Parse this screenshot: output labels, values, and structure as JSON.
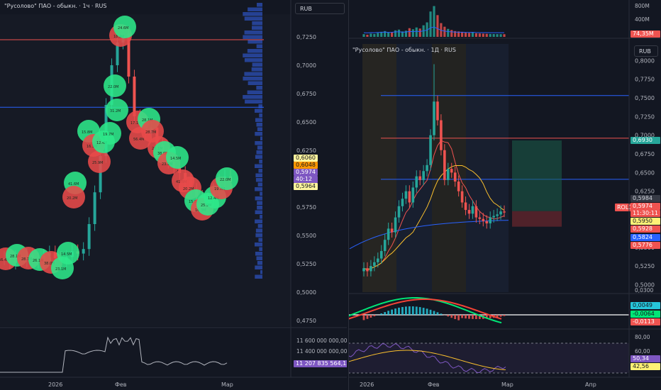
{
  "left_chart": {
    "title": "\"Русолово\" ПАО - обыкн. · 1ч · RUS",
    "currency_button": "RUB",
    "price_ticks": [
      "0,7250",
      "0,7000",
      "0,6750",
      "0,6500",
      "0,6250",
      "0,5750",
      "0,5500",
      "0,5250",
      "0,5000",
      "0,4750"
    ],
    "price_labels": [
      {
        "text": "0,6060",
        "bg": "#fff59d",
        "fg": "#131722"
      },
      {
        "text": "0,6048",
        "bg": "#ff9800",
        "fg": "#131722"
      },
      {
        "text": "0,5974",
        "bg": "#7e57c2",
        "fg": "#ffffff"
      },
      {
        "text": "40:12",
        "bg": "#7e57c2",
        "fg": "#ffffff"
      },
      {
        "text": "0,5964",
        "bg": "#fff59d",
        "fg": "#131722"
      }
    ],
    "volume_ticks": [
      "11 600 000 000,0000",
      "11 400 000 000,0000"
    ],
    "volume_label": {
      "text": "11 207 835 564,1570",
      "bg": "#7e57c2"
    },
    "time_labels": [
      "2026",
      "Фев",
      "Мар"
    ],
    "bubble_labels": [
      "56.4M",
      "28.1M",
      "28.7M",
      "26.1M",
      "38.0M",
      "23.1M",
      "14.5M",
      "41.6M",
      "20.2M",
      "15.8M",
      "16.3M",
      "25.9M",
      "12.4M",
      "19.7M",
      "22.0M",
      "31.2M",
      "18.3M",
      "24.6M",
      "17.1M"
    ],
    "colors": {
      "up": "#26a69a",
      "down": "#ef5350",
      "bubble_up": "#2ee88a",
      "bubble_down": "#e84a4a"
    }
  },
  "right_chart": {
    "title": "\"Русолово\" ПАО - обыкн. · 1Д · RUS",
    "currency_button": "RUB",
    "volume_ticks": [
      "800M",
      "400M"
    ],
    "volume_label": {
      "text": "74,35M",
      "bg": "#ef5350"
    },
    "price_ticks": [
      "0,8000",
      "0,7750",
      "0,7500",
      "0,7250",
      "0,7000",
      "0,6750",
      "0,6500",
      "0,6250",
      "0,6000",
      "0,5750",
      "0,5500",
      "0,5250",
      "0,5000"
    ],
    "symbol_badge": "ROLO",
    "price_labels": [
      {
        "text": "0,6930",
        "bg": "#26a69a",
        "fg": "#ffffff"
      },
      {
        "text": "0,5984",
        "bg": "#363a45",
        "fg": "#d1d4dc"
      },
      {
        "text": "0,5974",
        "bg": "#ef5350",
        "fg": "#ffffff"
      },
      {
        "text": "11:30:11",
        "bg": "#ef5350",
        "fg": "#ffffff"
      },
      {
        "text": "0,5950",
        "bg": "#fff176",
        "fg": "#131722"
      },
      {
        "text": "0,5928",
        "bg": "#ef5350",
        "fg": "#ffffff"
      },
      {
        "text": "0,5824",
        "bg": "#2962ff",
        "fg": "#ffffff"
      },
      {
        "text": "0,5776",
        "bg": "#ef5350",
        "fg": "#ffffff"
      }
    ],
    "macd_ticks": [
      "0,0300"
    ],
    "macd_labels": [
      {
        "text": "0,0049",
        "bg": "#26c6da",
        "fg": "#131722"
      },
      {
        "text": "-0,0064",
        "bg": "#00e676",
        "fg": "#131722"
      },
      {
        "text": "-0,0113",
        "bg": "#ef5350",
        "fg": "#ffffff"
      }
    ],
    "rsi_ticks": [
      "80,00",
      "60,00"
    ],
    "rsi_labels": [
      {
        "text": "50,34",
        "bg": "#7e57c2",
        "fg": "#ffffff"
      },
      {
        "text": "42,56",
        "bg": "#fff176",
        "fg": "#131722"
      }
    ],
    "time_labels": [
      "2026",
      "Фев",
      "Мар",
      "Апр"
    ],
    "h_lines": [
      {
        "price": 0.753,
        "color": "#2962ff"
      },
      {
        "price": 0.696,
        "color": "#ef5350"
      },
      {
        "price": 0.641,
        "color": "#2962ff"
      }
    ]
  },
  "chart_data": [
    {
      "type": "bar",
      "title": "\"Русолово\" ПАО - обыкн. · 1ч · RUS",
      "note": "hourly candles with volume bubbles",
      "ylim": [
        0.47,
        0.745
      ],
      "last_price": 0.5974,
      "series": [
        {
          "name": "",
          "values": [
            0.53,
            0.526,
            0.531,
            0.528,
            0.533,
            0.529,
            0.527,
            0.532,
            0.535,
            0.53,
            0.528,
            0.531,
            0.536,
            0.534,
            0.538,
            0.56,
            0.588,
            0.62,
            0.665,
            0.7,
            0.72,
            0.728,
            0.69,
            0.655,
            0.65,
            0.64,
            0.645,
            0.63,
            0.622,
            0.615,
            0.61,
            0.605,
            0.598,
            0.59,
            0.584,
            0.578,
            0.582,
            0.59,
            0.598,
            0.602,
            0.597
          ]
        }
      ]
    },
    {
      "type": "bar",
      "title": "\"Русолово\" ПАО - обыкн. · 1Д · RUS",
      "note": "daily candles, volume, MA lines, MACD, RSI",
      "ylim": [
        0.49,
        0.805
      ],
      "last_price": 0.5974,
      "series": [
        {
          "name": "",
          "values": [
            0.522,
            0.518,
            0.525,
            0.53,
            0.535,
            0.545,
            0.56,
            0.575,
            0.57,
            0.59,
            0.605,
            0.615,
            0.625,
            0.61,
            0.63,
            0.645,
            0.64,
            0.652,
            0.66,
            0.7,
            0.745,
            0.72,
            0.68,
            0.64,
            0.655,
            0.65,
            0.638,
            0.625,
            0.61,
            0.6,
            0.595,
            0.605,
            0.59,
            0.588,
            0.585,
            0.582,
            0.59,
            0.592,
            0.594,
            0.598,
            0.5974
          ]
        },
        {
          "name": "",
          "values": [
            75,
            60,
            90,
            80,
            110,
            140,
            160,
            120,
            130,
            180,
            200,
            150,
            170,
            240,
            210,
            260,
            230,
            320,
            400,
            700,
            850,
            600,
            380,
            280,
            220,
            190,
            160,
            150,
            140,
            120,
            110,
            130,
            100,
            95,
            90,
            85,
            80,
            78,
            76,
            75,
            74.35
          ]
        }
      ]
    }
  ]
}
